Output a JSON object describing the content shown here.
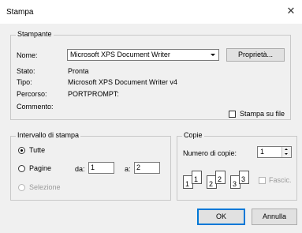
{
  "window": {
    "title": "Stampa"
  },
  "printer": {
    "legend": "Stampante",
    "name_label": "Nome:",
    "name_value": "Microsoft XPS Document Writer",
    "properties_button": "Proprietà...",
    "status_label": "Stato:",
    "status_value": "Pronta",
    "type_label": "Tipo:",
    "type_value": "Microsoft XPS Document Writer v4",
    "path_label": "Percorso:",
    "path_value": "PORTPROMPT:",
    "comment_label": "Commento:",
    "print_to_file_label": "Stampa su file"
  },
  "range": {
    "legend": "Intervallo di stampa",
    "all_label": "Tutte",
    "pages_label": "Pagine",
    "from_label": "da:",
    "from_value": "1",
    "to_label": "a:",
    "to_value": "2",
    "selection_label": "Selezione"
  },
  "copies": {
    "legend": "Copie",
    "count_label": "Numero di copie:",
    "count_value": "1",
    "collate_label": "Fascic.",
    "collate_icons": [
      "1",
      "1",
      "2",
      "2",
      "3",
      "3"
    ]
  },
  "buttons": {
    "ok": "OK",
    "cancel": "Annulla"
  },
  "icons": {
    "close": "close-icon",
    "dropdown": "chevron-down-icon"
  }
}
